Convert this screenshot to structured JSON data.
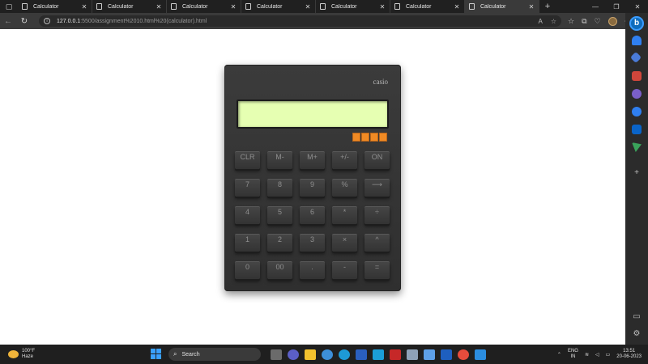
{
  "browser": {
    "tabs": [
      {
        "label": "Calculator",
        "active": false
      },
      {
        "label": "Calculator",
        "active": false
      },
      {
        "label": "Calculator",
        "active": false
      },
      {
        "label": "Calculator",
        "active": false
      },
      {
        "label": "Calculator",
        "active": false
      },
      {
        "label": "Calculator",
        "active": false
      },
      {
        "label": "Calculator",
        "active": true
      }
    ],
    "url_host": "127.0.0.1",
    "url_rest": ":5500/assignment%2010.html%20(calculator).html"
  },
  "calculator": {
    "brand": "casio",
    "display_value": "",
    "keys": [
      [
        "CLR",
        "M-",
        "M+",
        "+/-",
        "ON"
      ],
      [
        "7",
        "8",
        "9",
        "%",
        "⟶"
      ],
      [
        "4",
        "5",
        "6",
        "*",
        "÷"
      ],
      [
        "1",
        "2",
        "3",
        "×",
        "^"
      ],
      [
        "0",
        "00",
        ".",
        "-",
        "="
      ]
    ]
  },
  "taskbar": {
    "weather_temp": "100°F",
    "weather_desc": "Haze",
    "search_label": "Search",
    "lang_top": "ENG",
    "lang_bottom": "IN",
    "time": "13:51",
    "date": "20-06-2023"
  },
  "colors": {
    "display_bg": "#e6ffb2",
    "solar_cell": "#f08a24",
    "calc_body": "#333333"
  }
}
